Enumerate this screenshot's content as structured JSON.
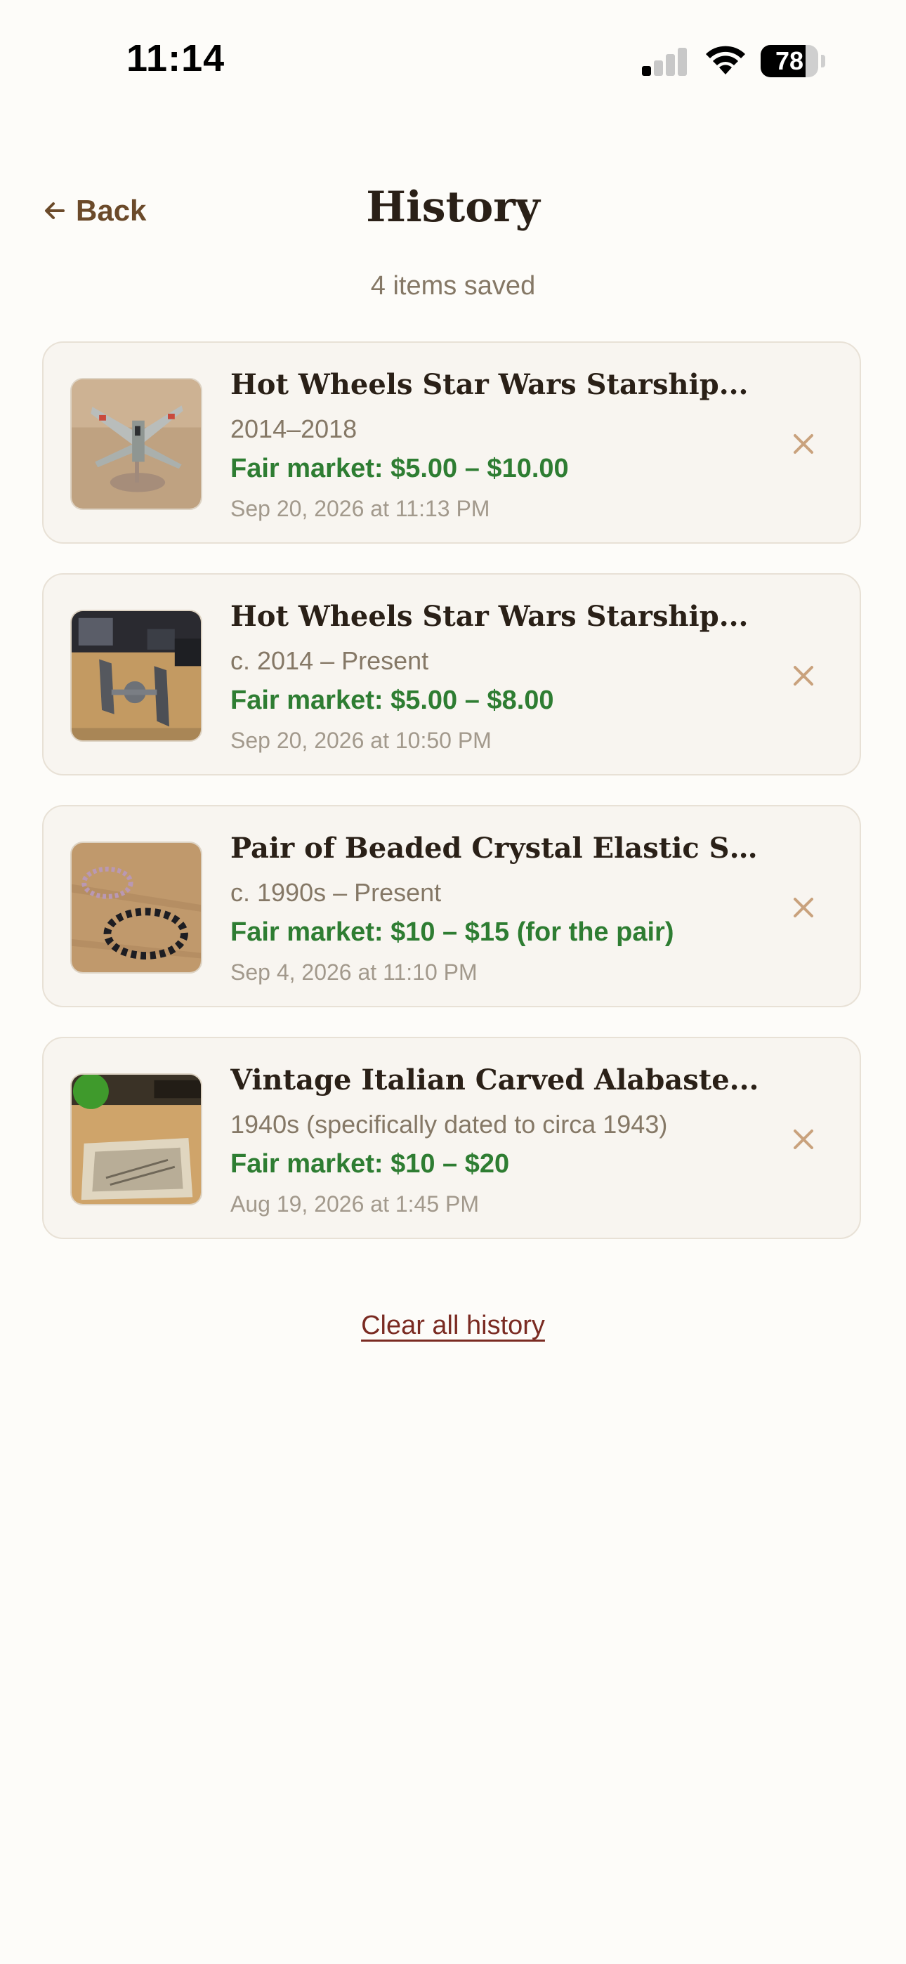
{
  "status_bar": {
    "time": "11:14",
    "battery_level": "78",
    "battery_fraction": 0.78
  },
  "header": {
    "back_label": "Back",
    "title": "History",
    "subtitle": "4 items saved"
  },
  "items": [
    {
      "title": "Hot Wheels Star Wars Starship...",
      "era": "2014–2018",
      "price": "Fair market: $5.00 – $10.00",
      "date": "Sep 20, 2026 at 11:13 PM",
      "thumb_icon": "x-wing-photo"
    },
    {
      "title": "Hot Wheels Star Wars Starship...",
      "era": "c. 2014 – Present",
      "price": "Fair market: $5.00 – $8.00",
      "date": "Sep 20, 2026 at 10:50 PM",
      "thumb_icon": "tie-fighter-photo"
    },
    {
      "title": "Pair of Beaded Crystal Elastic St...",
      "era": "c. 1990s – Present",
      "price": "Fair market: $10 – $15 (for the pair)",
      "date": "Sep 4, 2026 at 11:10 PM",
      "thumb_icon": "bracelets-photo"
    },
    {
      "title": "Vintage Italian Carved Alabaste...",
      "era": "1940s (specifically dated to circa 1943)",
      "price": "Fair market: $10 – $20",
      "date": "Aug 19, 2026 at 1:45 PM",
      "thumb_icon": "alabaster-box-photo"
    }
  ],
  "footer": {
    "clear_label": "Clear all history"
  },
  "colors": {
    "background": "#fdfcf9",
    "card": "#f8f5f0",
    "price_green": "#2e7d32",
    "accent_brown": "#6b4a2a",
    "delete_icon": "#c9a27d",
    "clear_link": "#7a2b22"
  }
}
